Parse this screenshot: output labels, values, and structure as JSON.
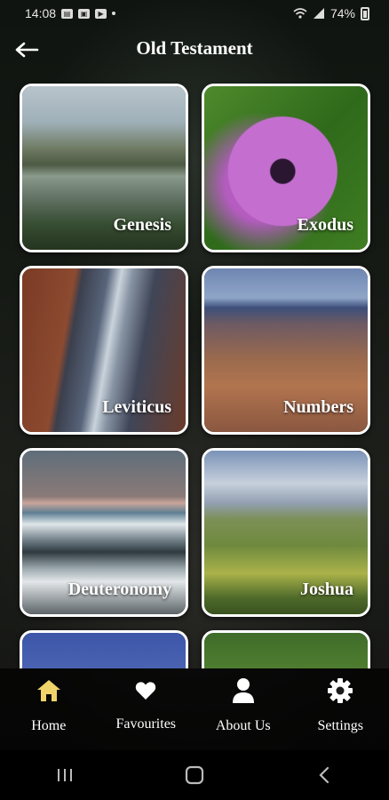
{
  "status_bar": {
    "time": "14:08",
    "battery": "74%"
  },
  "header": {
    "title": "Old Testament"
  },
  "books": [
    {
      "label": "Genesis"
    },
    {
      "label": "Exodus"
    },
    {
      "label": "Leviticus"
    },
    {
      "label": "Numbers"
    },
    {
      "label": "Deuteronomy"
    },
    {
      "label": "Joshua"
    }
  ],
  "bottom_nav": {
    "home": "Home",
    "favourites": "Favourites",
    "about": "About Us",
    "settings": "Settings"
  },
  "colors": {
    "accent": "#f0d36a",
    "card_border": "#ffffff"
  }
}
